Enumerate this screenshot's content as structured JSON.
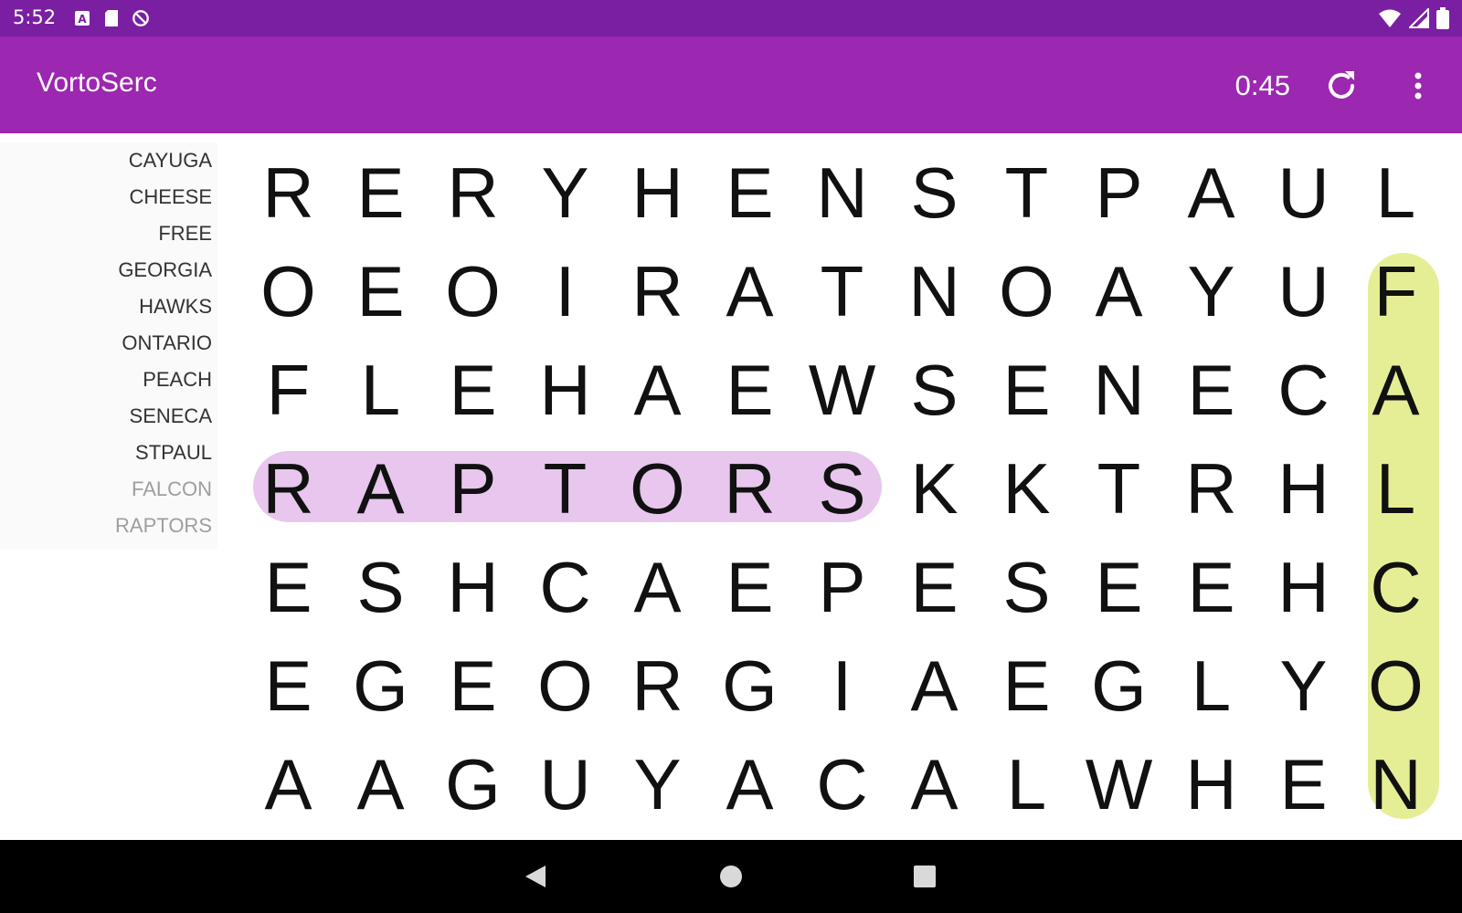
{
  "status_bar": {
    "time": "5:52",
    "left_icons": [
      "accessibility-icon",
      "sd-card-icon",
      "do-not-disturb-icon"
    ],
    "right_icons": [
      "wifi-icon",
      "cellular-signal-icon",
      "battery-icon"
    ]
  },
  "app_bar": {
    "title": "VortoSerc",
    "timer": "0:45",
    "refresh_icon": "refresh-icon",
    "menu_icon": "more-vert-icon"
  },
  "colors": {
    "status_bar": "#7b1fa2",
    "app_bar": "#9c27b0",
    "highlight_raptors": "#e8c6ee",
    "highlight_falcon": "#e6ee95",
    "found_word": "#9e9e9e"
  },
  "word_list": {
    "remaining": [
      "CAYUGA",
      "CHEESE",
      "FREE",
      "GEORGIA",
      "HAWKS",
      "ONTARIO",
      "PEACH",
      "SENECA",
      "STPAUL"
    ],
    "found": [
      "FALCON",
      "RAPTORS"
    ]
  },
  "grid": {
    "rows": [
      [
        "R",
        "E",
        "R",
        "Y",
        "H",
        "E",
        "N",
        "S",
        "T",
        "P",
        "A",
        "U",
        "L"
      ],
      [
        "O",
        "E",
        "O",
        "I",
        "R",
        "A",
        "T",
        "N",
        "O",
        "A",
        "Y",
        "U",
        "F"
      ],
      [
        "F",
        "L",
        "E",
        "H",
        "A",
        "E",
        "W",
        "S",
        "E",
        "N",
        "E",
        "C",
        "A"
      ],
      [
        "R",
        "A",
        "P",
        "T",
        "O",
        "R",
        "S",
        "K",
        "K",
        "T",
        "R",
        "H",
        "L"
      ],
      [
        "E",
        "S",
        "H",
        "C",
        "A",
        "E",
        "P",
        "E",
        "S",
        "E",
        "E",
        "H",
        "C"
      ],
      [
        "E",
        "G",
        "E",
        "O",
        "R",
        "G",
        "I",
        "A",
        "E",
        "G",
        "L",
        "Y",
        "O"
      ],
      [
        "A",
        "A",
        "G",
        "U",
        "Y",
        "A",
        "C",
        "A",
        "L",
        "W",
        "H",
        "E",
        "N"
      ]
    ]
  },
  "nav_bar": {
    "icons": [
      "back-icon",
      "home-icon",
      "recents-icon"
    ]
  }
}
